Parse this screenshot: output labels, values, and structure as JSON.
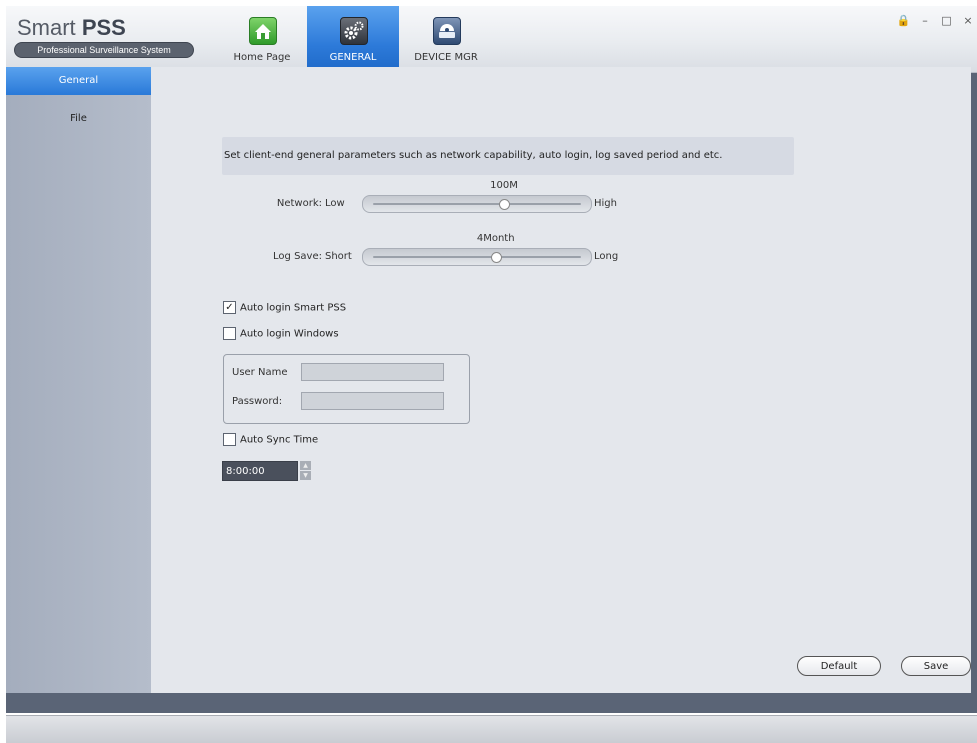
{
  "app": {
    "logo_title_main": "Smart",
    "logo_title_bold": "PSS",
    "logo_subtitle": "Professional Surveillance System"
  },
  "tabs": [
    {
      "label": "Home Page",
      "icon": "home-icon",
      "active": false
    },
    {
      "label": "GENERAL",
      "icon": "gear-icon",
      "active": true
    },
    {
      "label": "DEVICE MGR",
      "icon": "camera-icon",
      "active": false
    }
  ],
  "window_controls": {
    "lock": "🔒",
    "minimize": "–",
    "maximize": "□",
    "close": "×"
  },
  "sidebar": {
    "items": [
      {
        "label": "General",
        "active": true
      },
      {
        "label": "File",
        "active": false
      }
    ]
  },
  "main": {
    "description": "Set client-end general parameters such as network capability, auto login, log saved period and etc.",
    "network": {
      "label": "Network:",
      "low": "Low",
      "high": "High",
      "value": "100M",
      "position": 0.63
    },
    "log_save": {
      "label": "Log Save:",
      "low": "Short",
      "high": "Long",
      "value": "4Month",
      "position": 0.59
    },
    "auto_login_pss": {
      "label": "Auto login Smart PSS",
      "checked": true
    },
    "auto_login_windows": {
      "label": "Auto login Windows",
      "checked": false
    },
    "credentials": {
      "user_label": "User Name",
      "user_value": "",
      "password_label": "Password:",
      "password_value": ""
    },
    "auto_sync": {
      "label": "Auto Sync Time",
      "checked": false,
      "time": "8:00:00"
    },
    "buttons": {
      "default": "Default",
      "save": "Save"
    }
  },
  "colors": {
    "accent": "#2d7ad9",
    "sidebar": "#aab2c1",
    "panel": "#e4e7ec"
  }
}
